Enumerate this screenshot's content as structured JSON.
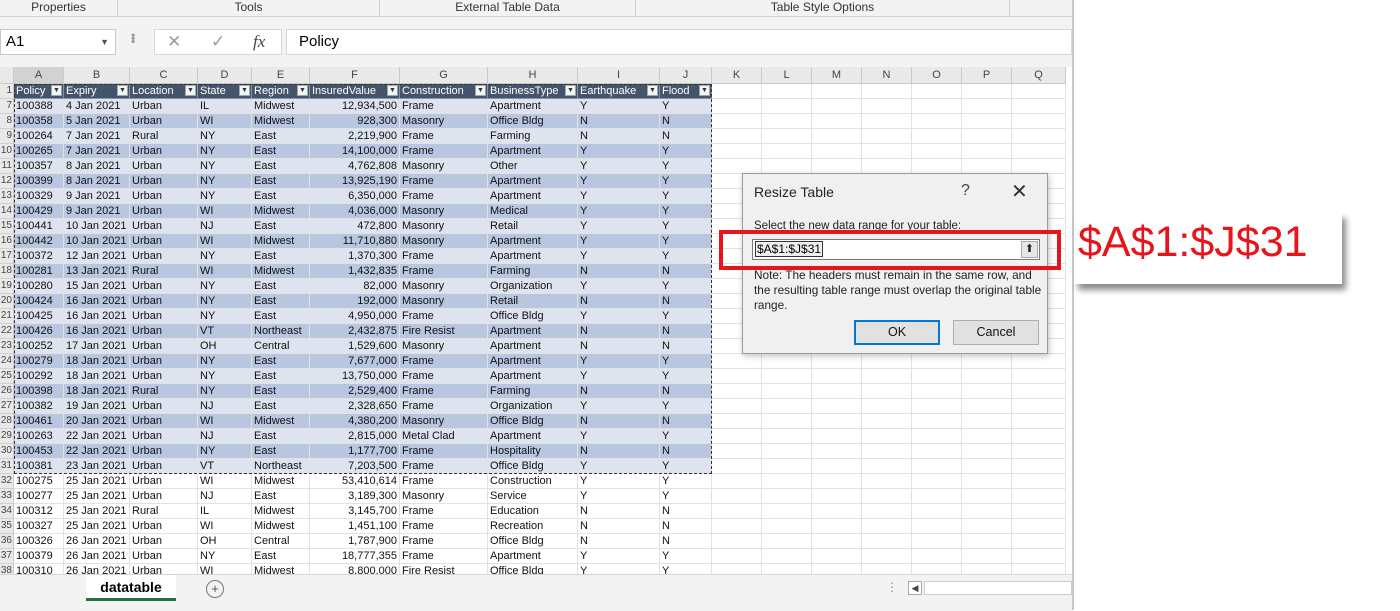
{
  "ribbon": {
    "groups": [
      "Properties",
      "Tools",
      "External Table Data",
      "Table Style Options"
    ]
  },
  "formula_bar": {
    "name_box": "A1",
    "formula": "Policy",
    "cancel_icon": "✕",
    "enter_icon": "✓",
    "fx_label": "fx"
  },
  "columns": [
    "A",
    "B",
    "C",
    "D",
    "E",
    "F",
    "G",
    "H",
    "I",
    "J",
    "K",
    "L",
    "M",
    "N",
    "O",
    "P",
    "Q"
  ],
  "table": {
    "headers": [
      "Policy",
      "Expiry",
      "Location",
      "State",
      "Region",
      "InsuredValue",
      "Construction",
      "BusinessType",
      "Earthquake",
      "Flood"
    ],
    "first_row_number": 1,
    "visible_start_row": 7,
    "rows": [
      [
        "100388",
        "4 Jan 2021",
        "Urban",
        "IL",
        "Midwest",
        "12,934,500",
        "Frame",
        "Apartment",
        "Y",
        "Y"
      ],
      [
        "100358",
        "5 Jan 2021",
        "Urban",
        "WI",
        "Midwest",
        "928,300",
        "Masonry",
        "Office Bldg",
        "N",
        "N"
      ],
      [
        "100264",
        "7 Jan 2021",
        "Rural",
        "NY",
        "East",
        "2,219,900",
        "Frame",
        "Farming",
        "N",
        "N"
      ],
      [
        "100265",
        "7 Jan 2021",
        "Urban",
        "NY",
        "East",
        "14,100,000",
        "Frame",
        "Apartment",
        "Y",
        "Y"
      ],
      [
        "100357",
        "8 Jan 2021",
        "Urban",
        "NY",
        "East",
        "4,762,808",
        "Masonry",
        "Other",
        "Y",
        "Y"
      ],
      [
        "100399",
        "8 Jan 2021",
        "Urban",
        "NY",
        "East",
        "13,925,190",
        "Frame",
        "Apartment",
        "Y",
        "Y"
      ],
      [
        "100329",
        "9 Jan 2021",
        "Urban",
        "NY",
        "East",
        "6,350,000",
        "Frame",
        "Apartment",
        "Y",
        "Y"
      ],
      [
        "100429",
        "9 Jan 2021",
        "Urban",
        "WI",
        "Midwest",
        "4,036,000",
        "Masonry",
        "Medical",
        "Y",
        "Y"
      ],
      [
        "100441",
        "10 Jan 2021",
        "Urban",
        "NJ",
        "East",
        "472,800",
        "Masonry",
        "Retail",
        "Y",
        "Y"
      ],
      [
        "100442",
        "10 Jan 2021",
        "Urban",
        "WI",
        "Midwest",
        "11,710,880",
        "Masonry",
        "Apartment",
        "Y",
        "Y"
      ],
      [
        "100372",
        "12 Jan 2021",
        "Urban",
        "NY",
        "East",
        "1,370,300",
        "Frame",
        "Apartment",
        "Y",
        "Y"
      ],
      [
        "100281",
        "13 Jan 2021",
        "Rural",
        "WI",
        "Midwest",
        "1,432,835",
        "Frame",
        "Farming",
        "N",
        "N"
      ],
      [
        "100280",
        "15 Jan 2021",
        "Urban",
        "NY",
        "East",
        "82,000",
        "Masonry",
        "Organization",
        "Y",
        "Y"
      ],
      [
        "100424",
        "16 Jan 2021",
        "Urban",
        "NY",
        "East",
        "192,000",
        "Masonry",
        "Retail",
        "N",
        "N"
      ],
      [
        "100425",
        "16 Jan 2021",
        "Urban",
        "NY",
        "East",
        "4,950,000",
        "Frame",
        "Office Bldg",
        "Y",
        "Y"
      ],
      [
        "100426",
        "16 Jan 2021",
        "Urban",
        "VT",
        "Northeast",
        "2,432,875",
        "Fire Resist",
        "Apartment",
        "N",
        "N"
      ],
      [
        "100252",
        "17 Jan 2021",
        "Urban",
        "OH",
        "Central",
        "1,529,600",
        "Masonry",
        "Apartment",
        "N",
        "N"
      ],
      [
        "100279",
        "18 Jan 2021",
        "Urban",
        "NY",
        "East",
        "7,677,000",
        "Frame",
        "Apartment",
        "Y",
        "Y"
      ],
      [
        "100292",
        "18 Jan 2021",
        "Urban",
        "NY",
        "East",
        "13,750,000",
        "Frame",
        "Apartment",
        "Y",
        "Y"
      ],
      [
        "100398",
        "18 Jan 2021",
        "Rural",
        "NY",
        "East",
        "2,529,400",
        "Frame",
        "Farming",
        "N",
        "N"
      ],
      [
        "100382",
        "19 Jan 2021",
        "Urban",
        "NJ",
        "East",
        "2,328,650",
        "Frame",
        "Organization",
        "Y",
        "Y"
      ],
      [
        "100461",
        "20 Jan 2021",
        "Urban",
        "WI",
        "Midwest",
        "4,380,200",
        "Masonry",
        "Office Bldg",
        "N",
        "N"
      ],
      [
        "100263",
        "22 Jan 2021",
        "Urban",
        "NJ",
        "East",
        "2,815,000",
        "Metal Clad",
        "Apartment",
        "Y",
        "Y"
      ],
      [
        "100453",
        "22 Jan 2021",
        "Urban",
        "NY",
        "East",
        "1,177,700",
        "Frame",
        "Hospitality",
        "N",
        "N"
      ],
      [
        "100381",
        "23 Jan 2021",
        "Urban",
        "VT",
        "Northeast",
        "7,203,500",
        "Frame",
        "Office Bldg",
        "Y",
        "Y"
      ]
    ],
    "rows_outside": [
      [
        "100275",
        "25 Jan 2021",
        "Urban",
        "WI",
        "Midwest",
        "53,410,614",
        "Frame",
        "Construction",
        "Y",
        "Y"
      ],
      [
        "100277",
        "25 Jan 2021",
        "Urban",
        "NJ",
        "East",
        "3,189,300",
        "Masonry",
        "Service",
        "Y",
        "Y"
      ],
      [
        "100312",
        "25 Jan 2021",
        "Rural",
        "IL",
        "Midwest",
        "3,145,700",
        "Frame",
        "Education",
        "N",
        "N"
      ],
      [
        "100327",
        "25 Jan 2021",
        "Urban",
        "WI",
        "Midwest",
        "1,451,100",
        "Frame",
        "Recreation",
        "N",
        "N"
      ],
      [
        "100326",
        "26 Jan 2021",
        "Urban",
        "OH",
        "Central",
        "1,787,900",
        "Frame",
        "Office Bldg",
        "N",
        "N"
      ],
      [
        "100379",
        "26 Jan 2021",
        "Urban",
        "NY",
        "East",
        "18,777,355",
        "Frame",
        "Apartment",
        "Y",
        "Y"
      ],
      [
        "100310",
        "26 Jan 2021",
        "Urban",
        "WI",
        "Midwest",
        "8,800,000",
        "Fire Resist",
        "Office Bldg",
        "Y",
        "Y"
      ]
    ]
  },
  "sheet_tabs": {
    "active": "datatable",
    "add_label": "+"
  },
  "dialog": {
    "title": "Resize Table",
    "help": "?",
    "close": "✕",
    "instruction": "Select the new data range for your table:",
    "range_value": "$A$1:$J$31",
    "collapse_icon": "⬆",
    "note": "Note: The headers must remain in the same row, and the resulting table range must overlap the original table range.",
    "ok_label": "OK",
    "cancel_label": "Cancel"
  },
  "callout": {
    "text": "$A$1:$J$31",
    "color": "#e8141c"
  },
  "colors": {
    "table_header": "#44546a",
    "band": "#b8c6e0",
    "highlight": "#e8141c",
    "accent": "#217346"
  }
}
